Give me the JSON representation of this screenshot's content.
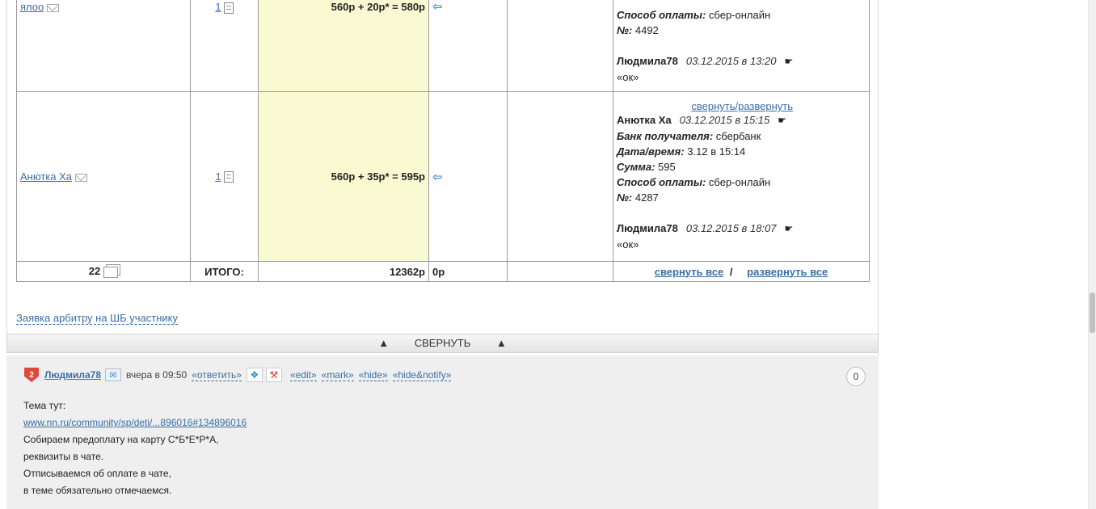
{
  "rows": [
    {
      "name": "ялоо",
      "qty": "1",
      "sum": "560р + 20р* = 580р",
      "details": [
        {
          "label": "Способ оплаты:",
          "value": "сбер-онлайн"
        },
        {
          "label": "№:",
          "value": "4492"
        }
      ],
      "reply": {
        "author": "Людмила78",
        "date": "03.12.2015 в 13:20",
        "text": "«ок»"
      }
    },
    {
      "name": "Анютка Ха",
      "qty": "1",
      "sum": "560р + 35р* = 595р",
      "toggle": "свернуть/развернуть",
      "entry": {
        "author": "Анютка Ха",
        "date": "03.12.2015 в 15:15"
      },
      "details": [
        {
          "label": "Банк получателя:",
          "value": "сбербанк"
        },
        {
          "label": "Дата/время:",
          "value": "3.12 в 15:14"
        },
        {
          "label": "Сумма:",
          "value": "595"
        },
        {
          "label": "Способ оплаты:",
          "value": "сбер-онлайн"
        },
        {
          "label": "№:",
          "value": "4287"
        }
      ],
      "reply": {
        "author": "Людмила78",
        "date": "03.12.2015 в 18:07",
        "text": "«ок»"
      }
    }
  ],
  "totals": {
    "count": "22",
    "label": "ИТОГО:",
    "sum": "12362р",
    "extra": "0р",
    "collapse_all": "свернуть все",
    "separator": "/",
    "expand_all": "развернуть все"
  },
  "arbiter_link": "Заявка арбитру на ШБ участнику",
  "collapse_bar": {
    "arrow": "▲",
    "label": "СВЕРНУТЬ"
  },
  "comment": {
    "badge": "2",
    "user": "Людмила78",
    "time": "вчера в 09:50",
    "reply": "«ответить»",
    "actions": [
      "«edit»",
      "«mark»",
      "«hide»",
      "«hide&notify»"
    ],
    "counter": "0",
    "lines": [
      "Тема тут:",
      "www.nn.ru/community/sp/deti/...896016#134896016",
      "Собираем предоплату на карту С*Б*Е*Р*А,",
      "реквизиты в чате.",
      "Отписываемся об оплате в чате,",
      "в теме обязательно отмечаемся."
    ]
  },
  "icons": {
    "mail": "mail-icon",
    "document": "document-icon",
    "arrow_left": "arrow-left-icon",
    "pointing_hand": "pointing-hand-icon",
    "stack": "stack-icon",
    "gift": "gift-icon",
    "hammer": "hammer-icon"
  },
  "colors": {
    "link": "#3a6ea5",
    "sum_bg": "#fafad2",
    "badge": "#e0483a"
  }
}
